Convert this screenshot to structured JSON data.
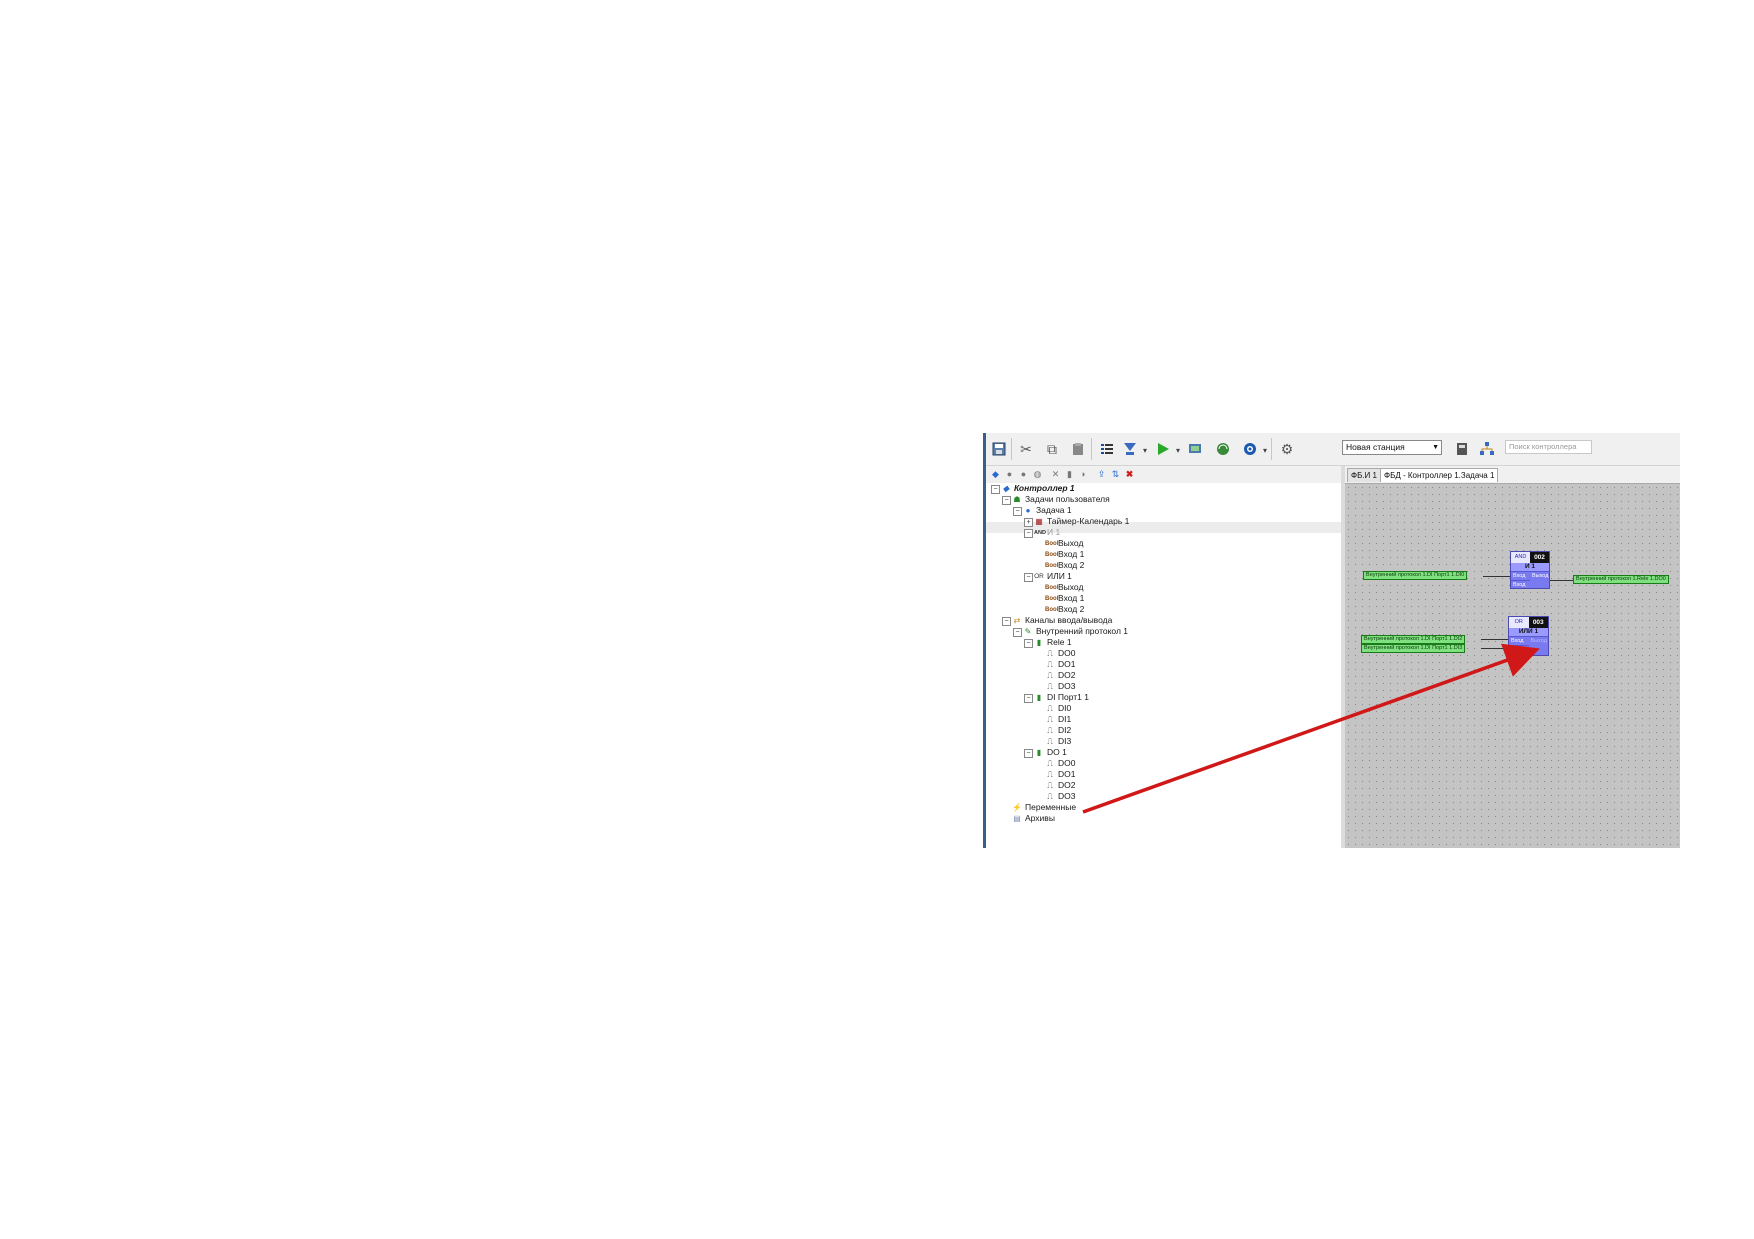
{
  "toolbar": {
    "station": "Новая станция",
    "search_placeholder": "Поиск контроллера"
  },
  "tree": [
    {
      "label": "Контроллер 1",
      "bold": true
    },
    {
      "label": "Задачи пользователя"
    },
    {
      "label": "Задача 1"
    },
    {
      "label": "Таймер-Календарь 1"
    },
    {
      "label": "И 1",
      "muted": true
    },
    {
      "label": "Выход"
    },
    {
      "label": "Вход 1"
    },
    {
      "label": "Вход 2"
    },
    {
      "label": "ИЛИ 1"
    },
    {
      "label": "Выход"
    },
    {
      "label": "Вход 1"
    },
    {
      "label": "Вход 2"
    },
    {
      "label": "Каналы ввода/вывода"
    },
    {
      "label": "Внутренний протокол 1"
    },
    {
      "label": "Rele 1"
    },
    {
      "label": "DO0"
    },
    {
      "label": "DO1"
    },
    {
      "label": "DO2"
    },
    {
      "label": "DO3"
    },
    {
      "label": "DI Порт1 1"
    },
    {
      "label": "DI0"
    },
    {
      "label": "DI1"
    },
    {
      "label": "DI2"
    },
    {
      "label": "DI3"
    },
    {
      "label": "DO 1"
    },
    {
      "label": "DO0"
    },
    {
      "label": "DO1"
    },
    {
      "label": "DO2"
    },
    {
      "label": "DO3"
    },
    {
      "label": "Переменные"
    },
    {
      "label": "Архивы"
    }
  ],
  "tree_icons": {
    "and": "AND",
    "or": "OR",
    "bool": "Bool"
  },
  "tabs": [
    {
      "label": "ФБ.И 1"
    },
    {
      "label": "ФБД - Контроллер 1.Задача 1"
    }
  ],
  "canvas": {
    "links": {
      "in_and": "Внутренний протокол 1.DI Порт1 1.DI0",
      "out_and": "Внутренний протокол 1.Rele 1.DO0",
      "in_or_1": "Внутренний протокол 1.DI Порт1 1.DI2",
      "in_or_2": "Внутренний протокол 1.DI Порт1 1.DI3"
    },
    "blocks": {
      "and": {
        "type": "AND",
        "id": "002",
        "name": "И 1",
        "in1": "Вход",
        "in2": "Вход",
        "out": "Выход"
      },
      "or": {
        "type": "OR",
        "id": "003",
        "name": "ИЛИ 1",
        "in1": "Вход",
        "in2": "Вход",
        "out": "Выход"
      }
    }
  },
  "colors": {
    "arrow": "#d01818",
    "block": "#7a7af0",
    "link": "#7fe07f"
  }
}
